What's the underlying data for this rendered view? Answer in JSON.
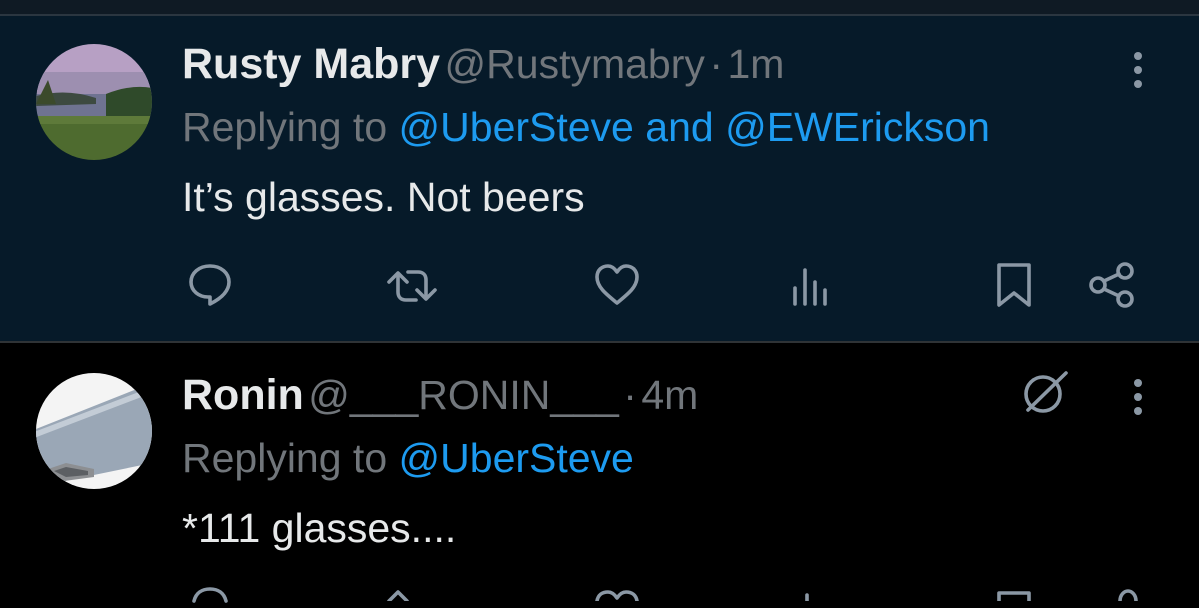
{
  "tweets": [
    {
      "author_name": "Rusty Mabry",
      "handle": "@Rustymabry",
      "separator": "·",
      "time": "1m",
      "replying_prefix": "Replying to",
      "reply_mentions": [
        "@UberSteve",
        "@EWErickson"
      ],
      "mention_joiner": "and",
      "text": "It’s glasses. Not beers",
      "actions": [
        "reply-icon",
        "retweet-icon",
        "like-icon",
        "views-icon",
        "bookmark-icon",
        "share-icon"
      ],
      "highlighted": true
    },
    {
      "author_name": "Ronin",
      "handle": "@___RONIN___",
      "separator": "·",
      "time": "4m",
      "replying_prefix": "Replying to",
      "reply_mentions": [
        "@UberSteve"
      ],
      "text": "*111 glasses....",
      "badge_icon": "circle-slash-icon",
      "highlighted": false
    }
  ],
  "colors": {
    "highlight_bg": "#061a29",
    "mention": "#1d9bf0",
    "secondary_text": "#71767b",
    "primary_text": "#e7e9ea"
  }
}
